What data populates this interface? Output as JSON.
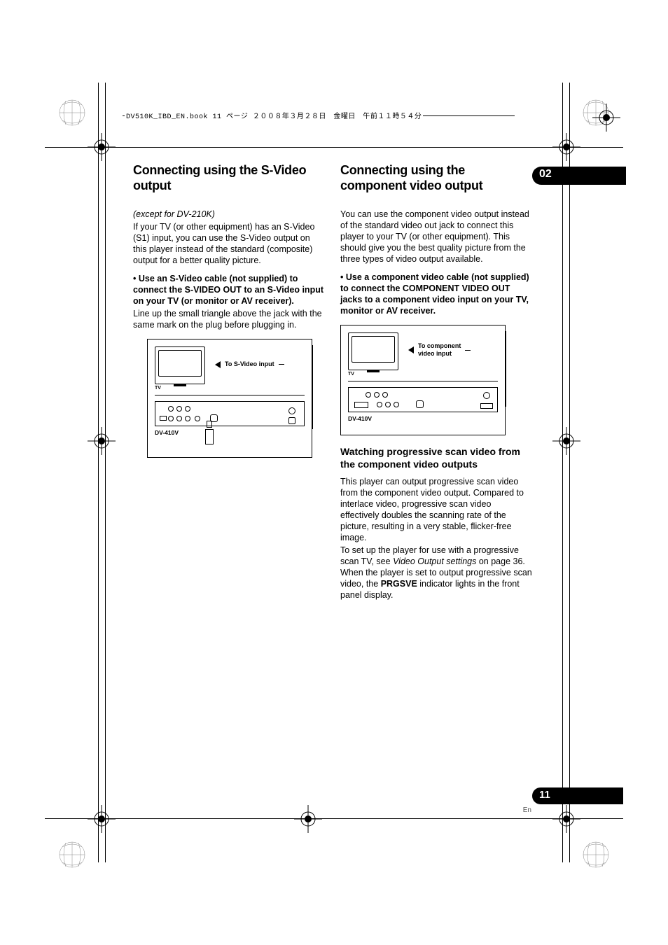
{
  "header_line": "DV510K_IBD_EN.book  11 ページ  ２００８年３月２８日　金曜日　午前１１時５４分",
  "chapter_num": "02",
  "page_num": "11",
  "lang": "En",
  "col_left": {
    "h1": "Connecting using the S-Video output",
    "except": "(except for DV-210K)",
    "p1": "If your TV (or other equipment) has an S-Video (S1) input, you can use the S-Video output on this player instead of the standard (composite) output for a better quality picture.",
    "bullet_prefix": "•    ",
    "bullet_bold": "Use an S-Video cable (not supplied) to connect the S-VIDEO OUT to an S-Video input on your TV (or monitor or AV receiver).",
    "p2": "Line up the small triangle above the jack with the same mark on the plug before plugging in.",
    "diagram": {
      "lead": "To S-Video input",
      "tv_label": "TV",
      "model": "DV-410V"
    }
  },
  "col_right": {
    "h1": "Connecting using the component video output",
    "p1": "You can use the component video output instead of the standard video out jack to connect this player to your TV (or other equipment). This should give you the best quality picture from the three types of video output available.",
    "bullet_prefix": "•    ",
    "bullet_bold": "Use a component video cable (not supplied) to connect the COMPONENT VIDEO OUT jacks to a component video input on your TV, monitor or AV receiver.",
    "diagram": {
      "lead1": "To component",
      "lead2": "video input",
      "tv_label": "TV",
      "model": "DV-410V"
    },
    "h2": "Watching progressive scan video from the component video outputs",
    "p2": "This player can output progressive scan video from the component video output. Compared to interlace video, progressive scan video effectively doubles the scanning rate of the picture, resulting in a very stable, flicker-free image.",
    "p3a": "To set up the player for use with a progressive scan TV, see ",
    "p3i": "Video Output settings",
    "p3b": " on page 36. When the player is set to output progressive scan video, the ",
    "p3bold": "PRGSVE",
    "p3c": " indicator lights in the front panel display."
  }
}
